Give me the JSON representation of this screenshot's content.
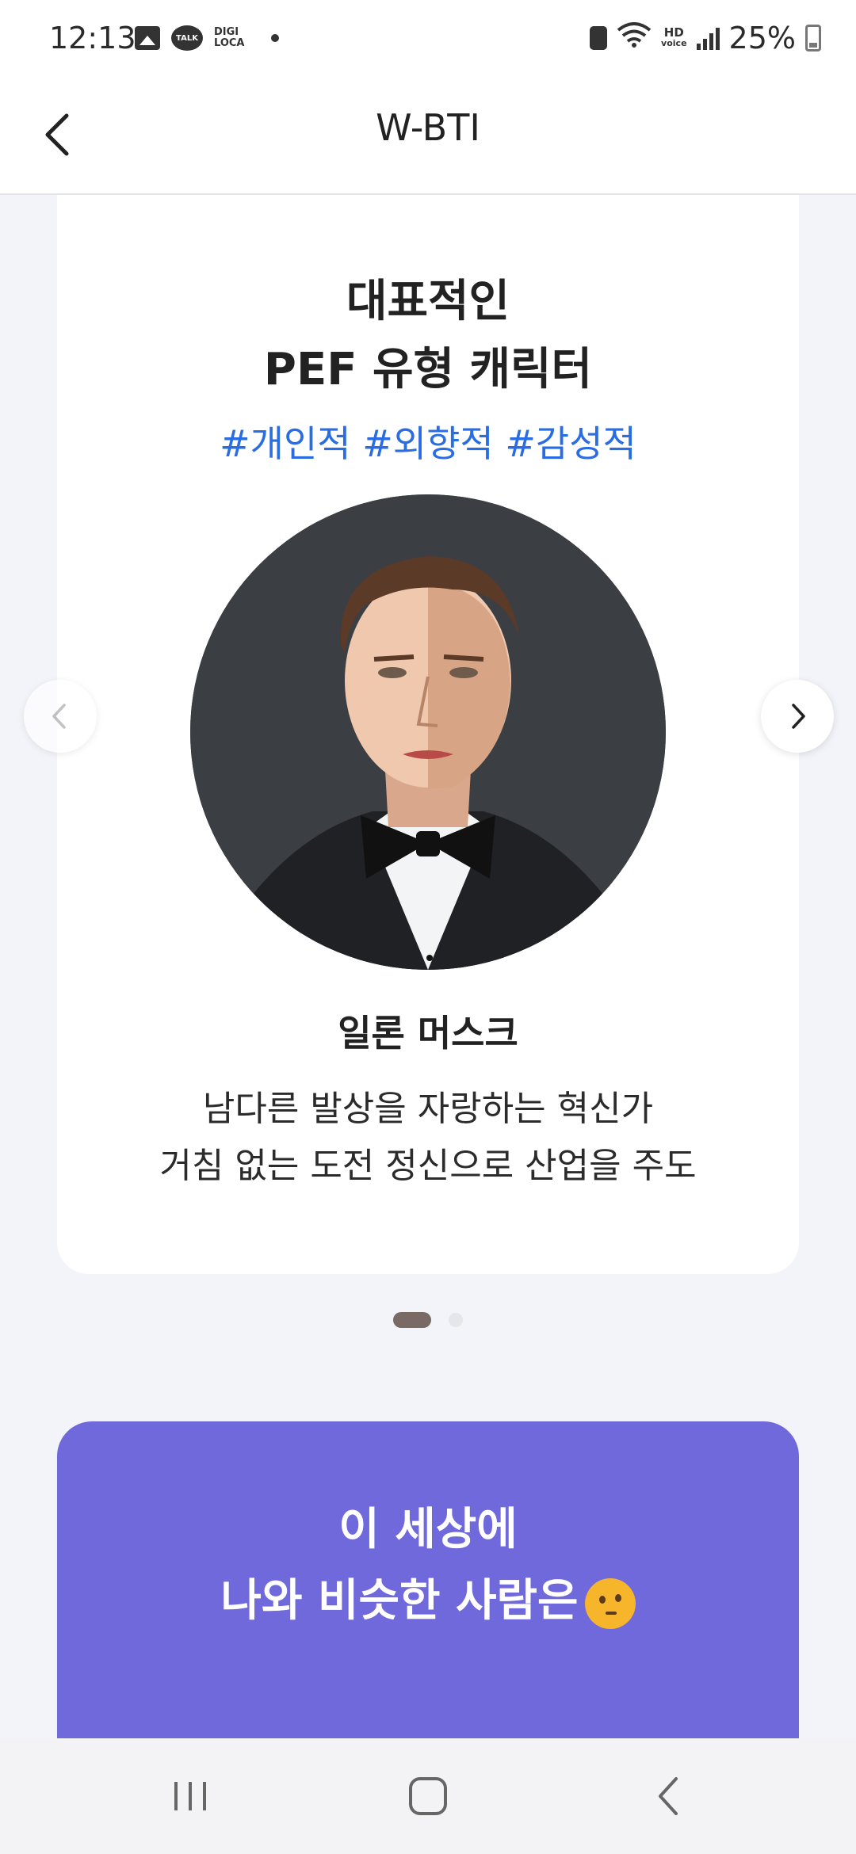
{
  "status_bar": {
    "time": "12:13",
    "talk_label": "TALK",
    "digi_label_1": "DIGI",
    "digi_label_2": "LOCA",
    "hd_label_1": "HD",
    "hd_label_2": "voice",
    "battery": "25%"
  },
  "app_bar": {
    "title": "W-BTI"
  },
  "card": {
    "title_line1": "대표적인",
    "title_line2": "PEF 유형 캐릭터",
    "hashtags": "#개인적 #외향적 #감성적",
    "person_name": "일론 머스크",
    "desc_line1": "남다른 발상을 자랑하는 혁신가",
    "desc_line2": "거침 없는 도전 정신으로 산업을 주도"
  },
  "carousel": {
    "current_page": 1,
    "total_pages": 2
  },
  "promo": {
    "line1": "이 세상에",
    "line2": "나와 비슷한 사람은",
    "emoji": "thinking-face-emoji"
  },
  "colors": {
    "accent_blue": "#2a6de2",
    "promo_purple": "#6f69dc",
    "background": "#f3f4f9"
  }
}
